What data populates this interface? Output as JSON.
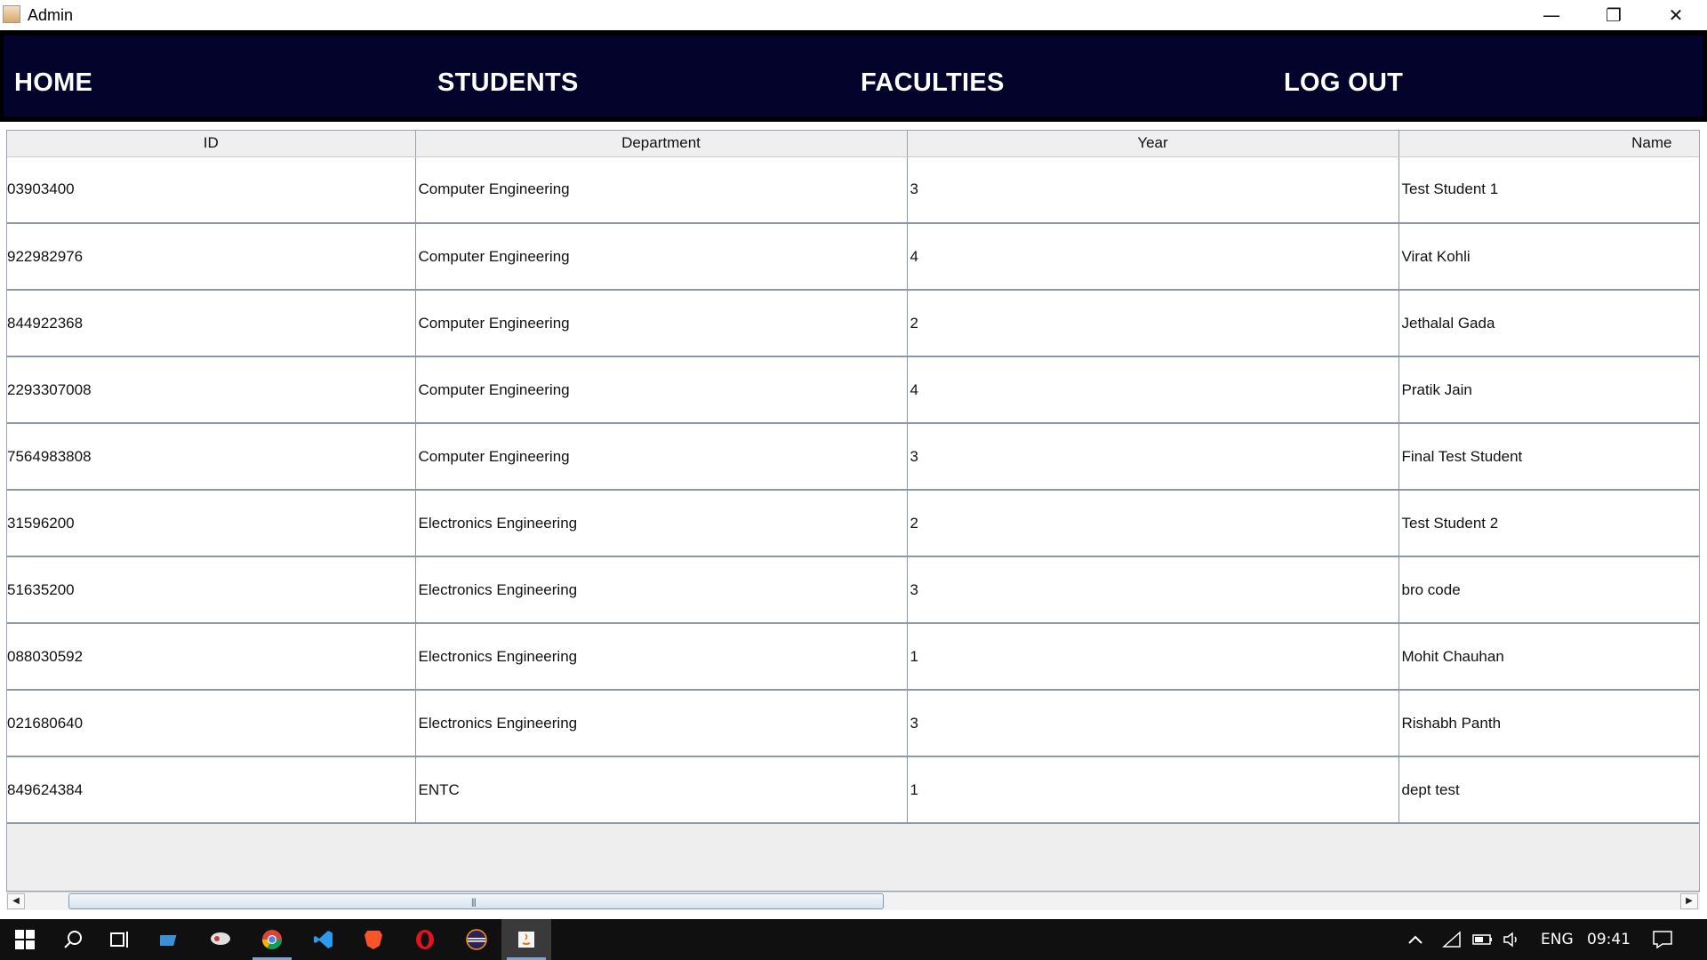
{
  "window": {
    "title": "Admin",
    "minimize": "—",
    "restore": "❐",
    "close": "✕"
  },
  "nav": {
    "home": "HOME",
    "students": "STUDENTS",
    "faculties": "FACULTIES",
    "logout": "LOG OUT"
  },
  "table": {
    "headers": [
      "ID",
      "Department",
      "Year",
      "Name"
    ],
    "rows": [
      [
        "03903400",
        "Computer Engineering",
        "3",
        "Test Student 1"
      ],
      [
        "922982976",
        "Computer Engineering",
        "4",
        "Virat Kohli"
      ],
      [
        "844922368",
        "Computer Engineering",
        "2",
        "Jethalal Gada"
      ],
      [
        "2293307008",
        "Computer Engineering",
        "4",
        "Pratik Jain"
      ],
      [
        "7564983808",
        "Computer Engineering",
        "3",
        "Final Test Student"
      ],
      [
        "31596200",
        "Electronics Engineering",
        "2",
        "Test Student 2"
      ],
      [
        "51635200",
        "Electronics Engineering",
        "3",
        "bro code"
      ],
      [
        "088030592",
        "Electronics Engineering",
        "1",
        "Mohit Chauhan"
      ],
      [
        "021680640",
        "Electronics Engineering",
        "3",
        "Rishabh Panth"
      ],
      [
        "849624384",
        "ENTC",
        "1",
        "dept test"
      ]
    ]
  },
  "scrollbar": {
    "left_arrow": "◀",
    "right_arrow": "▶",
    "grip": "|||"
  },
  "taskbar": {
    "icons": [
      "windows-start-icon",
      "search-icon",
      "task-view-icon",
      "app-icon",
      "app-icon",
      "chrome-icon",
      "vscode-icon",
      "brave-icon",
      "opera-icon",
      "eclipse-icon",
      "java-icon"
    ],
    "language": "ENG",
    "time": "09:41"
  },
  "colors": {
    "nav_bg": "#03032b",
    "accent": "#7aa7d8"
  }
}
